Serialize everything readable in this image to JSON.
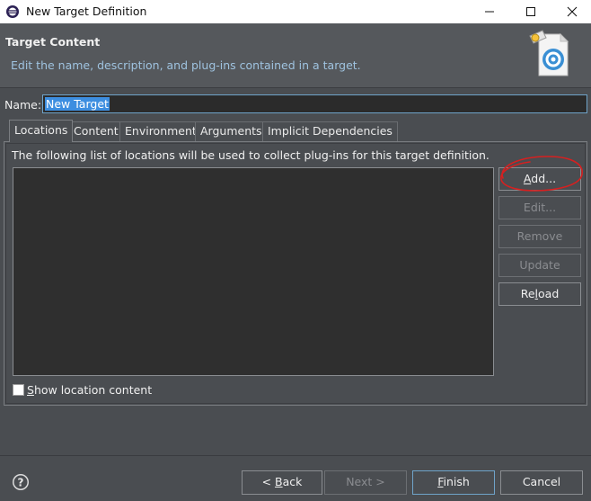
{
  "window": {
    "title": "New Target Definition",
    "minimize": "—",
    "maximize": "☐",
    "close": "✕"
  },
  "banner": {
    "title": "Target Content",
    "description": "Edit the name, description, and plug-ins contained in a target.",
    "icon": "target-definition-wizard-icon"
  },
  "name": {
    "label": "Name:",
    "value": "New Target"
  },
  "tabs": [
    {
      "label": "Locations",
      "active": true
    },
    {
      "label": "Content",
      "active": false
    },
    {
      "label": "Environment",
      "active": false
    },
    {
      "label": "Arguments",
      "active": false
    },
    {
      "label": "Implicit Dependencies",
      "active": false
    }
  ],
  "locations": {
    "description": "The following list of locations will be used to collect plug-ins for this target definition.",
    "buttons": {
      "add": {
        "pre": "",
        "mn": "A",
        "post": "dd..."
      },
      "edit": {
        "label": "Edit..."
      },
      "remove": {
        "label": "Remove"
      },
      "update": {
        "label": "Update"
      },
      "reload": {
        "pre": "Re",
        "mn": "l",
        "post": "oad"
      }
    },
    "show_content": {
      "mn": "S",
      "post": "how location content",
      "checked": false
    }
  },
  "footer": {
    "back": {
      "pre": "< ",
      "mn": "B",
      "post": "ack"
    },
    "next": {
      "label": "Next >"
    },
    "finish": {
      "mn": "F",
      "post": "inish"
    },
    "cancel": {
      "label": "Cancel"
    }
  },
  "colors": {
    "background": "#4a4d51",
    "banner": "#55585c",
    "list": "#2f2f2f",
    "selection": "#3d8ee0",
    "focus_border": "#6fa3c9",
    "annotation": "#d62020"
  }
}
